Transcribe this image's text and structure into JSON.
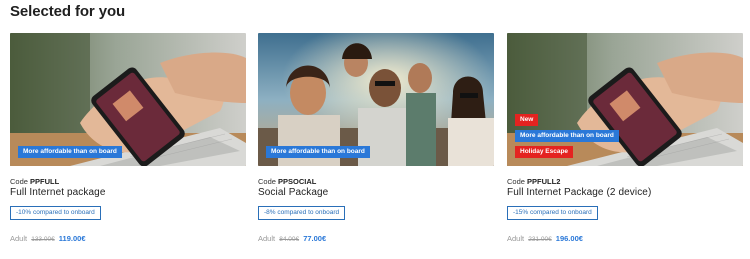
{
  "section": {
    "title": "Selected for you"
  },
  "cards": [
    {
      "image_alt": "hands holding phone over laptop",
      "badges": [
        {
          "label": "More affordable than on board",
          "color": "#2a78d8"
        }
      ],
      "code_label": "Code",
      "code": "PPFULL",
      "name": "Full Internet package",
      "discount": "-10% compared to onboard",
      "price_label": "Adult",
      "old_price": "133.00€",
      "new_price": "119.00€"
    },
    {
      "image_alt": "group of friends taking a selfie",
      "badges": [
        {
          "label": "More affordable than on board",
          "color": "#2a78d8"
        }
      ],
      "code_label": "Code",
      "code": "PPSOCIAL",
      "name": "Social Package",
      "discount": "-8% compared to onboard",
      "price_label": "Adult",
      "old_price": "84.00€",
      "new_price": "77.00€"
    },
    {
      "image_alt": "hands holding phone over laptop",
      "badges": [
        {
          "label": "New",
          "color": "#e42320"
        },
        {
          "label": "More affordable than on board",
          "color": "#2a78d8"
        },
        {
          "label": "Holiday Escape",
          "color": "#e42320"
        }
      ],
      "code_label": "Code",
      "code": "PPFULL2",
      "name": "Full Internet Package (2 device)",
      "discount": "-15% compared to onboard",
      "price_label": "Adult",
      "old_price": "231.00€",
      "new_price": "196.00€"
    }
  ],
  "colors": {
    "accent": "#2a78d8",
    "badge_red": "#e42320",
    "discount_border": "#2a6fb8"
  }
}
